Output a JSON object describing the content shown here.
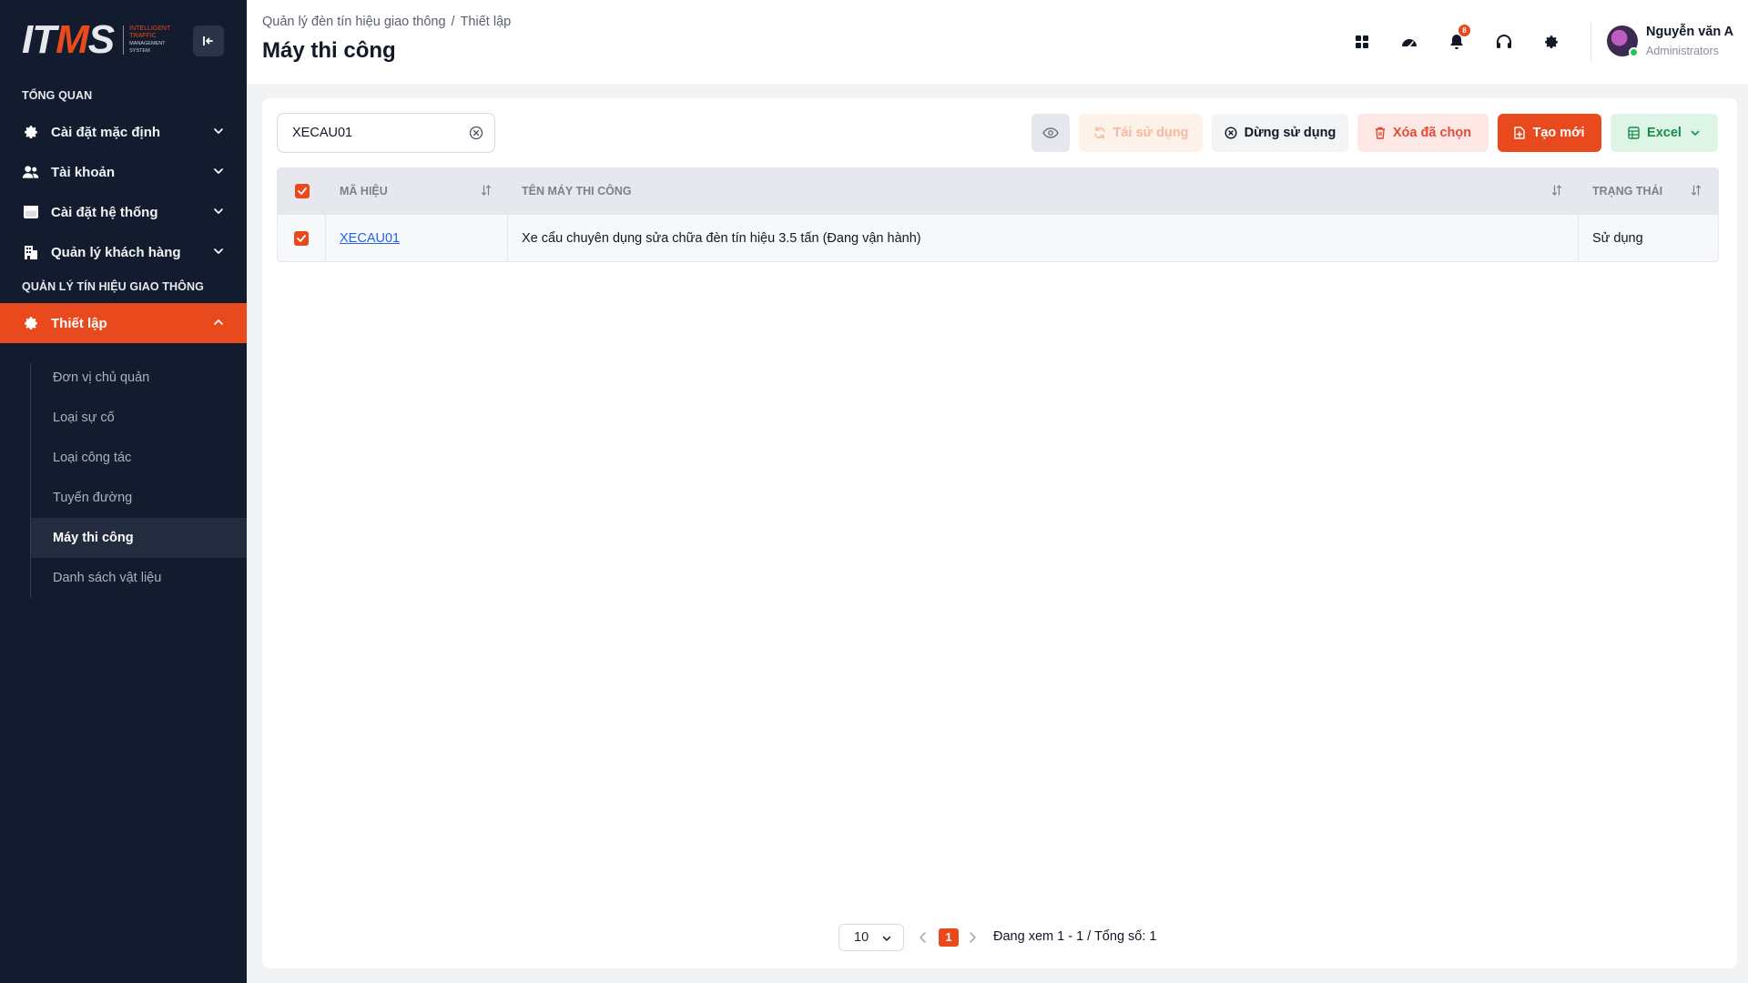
{
  "brand": {
    "logo_text": "ITMS",
    "logo_sub": [
      "INTELLIGENT",
      "TRAFFIC",
      "MANAGEMENT",
      "SYSTEM"
    ],
    "accent_color": "#e8491d",
    "sidebar_bg": "#131c2e"
  },
  "sidebar": {
    "section_overview": "TỔNG QUAN",
    "section_traffic": "QUẢN LÝ TÍN HIỆU GIAO THÔNG",
    "items": [
      {
        "label": "Cài đặt mặc định",
        "icon": "gear-icon"
      },
      {
        "label": "Tài khoản",
        "icon": "users-icon"
      },
      {
        "label": "Cài đặt hệ thống",
        "icon": "window-icon"
      },
      {
        "label": "Quản lý khách hàng",
        "icon": "building-icon"
      }
    ],
    "active_group": {
      "label": "Thiết lập",
      "icon": "gear-icon"
    },
    "sub_items": [
      {
        "label": "Đơn vị chủ quản"
      },
      {
        "label": "Loại sự cố"
      },
      {
        "label": "Loại công tác"
      },
      {
        "label": "Tuyến đường"
      },
      {
        "label": "Máy thi công",
        "active": true
      },
      {
        "label": "Danh sách vật liệu"
      }
    ]
  },
  "header": {
    "breadcrumb": [
      "Quản lý đèn tín hiệu giao thông",
      "Thiết lập"
    ],
    "breadcrumb_sep": "/",
    "title": "Máy thi công",
    "icons": [
      "apps-grid-icon",
      "dashboard-gauge-icon",
      "bell-icon",
      "headset-icon",
      "gear-icon"
    ],
    "notification_count": "8",
    "user": {
      "name": "Nguyễn văn A",
      "role": "Administrators",
      "status": "online"
    }
  },
  "toolbar": {
    "search_value": "XECAU01",
    "reuse_label": "Tái sử dụng",
    "stop_label": "Dừng sử dụng",
    "delete_label": "Xóa đã chọn",
    "create_label": "Tạo mới",
    "excel_label": "Excel"
  },
  "table": {
    "columns": [
      "MÃ HIỆU",
      "TÊN MÁY THI CÔNG",
      "TRẠNG THÁI"
    ],
    "rows": [
      {
        "code": "XECAU01",
        "name": "Xe cẩu chuyên dụng sửa chữa đèn tín hiệu 3.5 tấn (Đang vận hành)",
        "status": "Sử dụng",
        "checked": true
      }
    ],
    "header_checked": true
  },
  "pagination": {
    "page_size": "10",
    "current_page": "1",
    "info": "Đang xem 1 - 1 / Tổng số: 1"
  }
}
